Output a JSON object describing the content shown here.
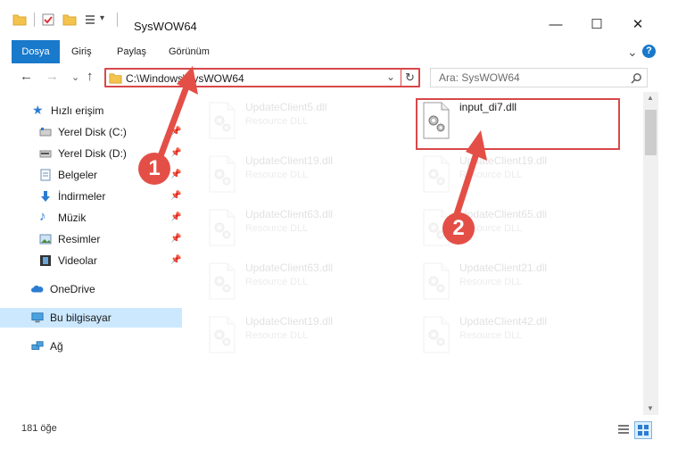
{
  "window": {
    "title": "SysWOW64",
    "minimize": "—",
    "maximize": "☐",
    "close": "✕"
  },
  "ribbon": {
    "tabs": [
      "Dosya",
      "Giriş",
      "Paylaş",
      "Görünüm"
    ],
    "expand": "⌄",
    "help": "?"
  },
  "nav": {
    "back": "←",
    "forward": "→",
    "recent": "⌄",
    "up": "↑",
    "address": "C:\\Windows\\SysWOW64",
    "address_dropdown": "⌄",
    "refresh": "↻",
    "search_placeholder": "Ara: SysWOW64"
  },
  "sidebar": {
    "items": [
      {
        "label": "Hızlı erişim",
        "icon": "star-icon",
        "color": "#2b7cd3"
      },
      {
        "label": "Yerel Disk (C:)",
        "icon": "drive-icon",
        "pinned": true
      },
      {
        "label": "Yerel Disk (D:)",
        "icon": "drive-icon",
        "pinned": true
      },
      {
        "label": "Belgeler",
        "icon": "documents-icon",
        "pinned": true
      },
      {
        "label": "İndirmeler",
        "icon": "downloads-icon",
        "pinned": true
      },
      {
        "label": "Müzik",
        "icon": "music-icon",
        "pinned": true
      },
      {
        "label": "Resimler",
        "icon": "pictures-icon",
        "pinned": true
      },
      {
        "label": "Videolar",
        "icon": "videos-icon",
        "pinned": true
      },
      {
        "label": "OneDrive",
        "icon": "cloud-icon"
      },
      {
        "label": "Bu bilgisayar",
        "icon": "computer-icon",
        "selected": true
      },
      {
        "label": "Ağ",
        "icon": "network-icon"
      }
    ]
  },
  "files": [
    {
      "name": "UpdateClient5.dll",
      "desc": "Resource DLL",
      "faded": true
    },
    {
      "name": "input_di7.dll",
      "desc": "",
      "faded": false
    },
    {
      "name": "UpdateClient19.dll",
      "desc": "Resource DLL",
      "faded": true
    },
    {
      "name": "UpdateClient19.dll",
      "desc": "Resource DLL",
      "faded": true
    },
    {
      "name": "UpdateClient63.dll",
      "desc": "Resource DLL",
      "faded": true
    },
    {
      "name": "UpdateClient65.dll",
      "desc": "Resource DLL",
      "faded": true
    },
    {
      "name": "UpdateClient63.dll",
      "desc": "Resource DLL",
      "faded": true
    },
    {
      "name": "UpdateClient21.dll",
      "desc": "Resource DLL",
      "faded": true
    },
    {
      "name": "UpdateClient19.dll",
      "desc": "Resource DLL",
      "faded": true
    },
    {
      "name": "UpdateClient42.dll",
      "desc": "Resource DLL",
      "faded": true
    }
  ],
  "status": {
    "count": "181 öğe"
  },
  "annotations": {
    "step1": "1",
    "step2": "2",
    "color": "#e34f47"
  }
}
